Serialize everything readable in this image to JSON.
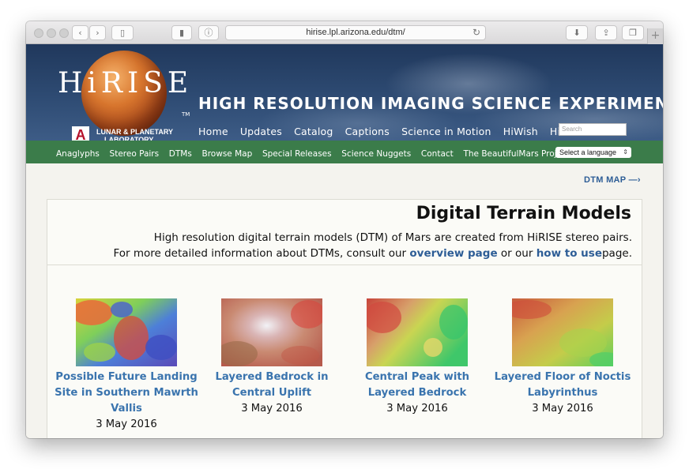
{
  "browser": {
    "url": "hirise.lpl.arizona.edu/dtm/"
  },
  "header": {
    "logo_text": "HiRISE",
    "trademark": "TM",
    "lpl_line1": "LUNAR & PLANETARY",
    "lpl_line2": "LABORATORY",
    "site_title": "HIGH RESOLUTION IMAGING SCIENCE EXPERIMENT",
    "nav": [
      "Home",
      "Updates",
      "Catalog",
      "Captions",
      "Science in Motion",
      "HiWish",
      "HiView"
    ],
    "search_placeholder": "Search"
  },
  "subnav": {
    "items": [
      "Anaglyphs",
      "Stereo Pairs",
      "DTMs",
      "Browse Map",
      "Special Releases",
      "Science Nuggets",
      "Contact",
      "The BeautifulMars Project"
    ],
    "language_select": "Select a language"
  },
  "main": {
    "dtm_map_link": "DTM MAP —›",
    "title": "Digital Terrain Models",
    "intro_line1": "High resolution digital terrain models (DTM) of Mars are created from HiRISE stereo pairs.",
    "intro_line2_before": "For more detailed information about DTMs, consult our",
    "overview_link": "overview page",
    "intro_line2_mid": "or our",
    "howto_link": "how to use",
    "intro_line2_after": "page.",
    "items": [
      {
        "title_lines": [
          "Possible Future Landing",
          "Site in Southern Mawrth",
          "Vallis"
        ],
        "date": "3 May 2016"
      },
      {
        "title_lines": [
          "Layered Bedrock in",
          "Central Uplift"
        ],
        "date": "3 May 2016"
      },
      {
        "title_lines": [
          "Central Peak with",
          "Layered Bedrock"
        ],
        "date": "3 May 2016"
      },
      {
        "title_lines": [
          "Layered Floor of Noctis",
          "Labyrinthus"
        ],
        "date": "3 May 2016"
      }
    ]
  }
}
